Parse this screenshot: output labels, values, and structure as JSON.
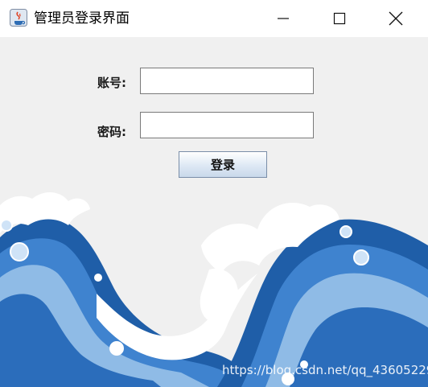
{
  "window": {
    "title": "管理员登录界面"
  },
  "form": {
    "account_label": "账号:",
    "account_value": "",
    "password_label": "密码:",
    "password_value": "",
    "login_label": "登录"
  },
  "watermark": "https://blog.csdn.net/qq_43605229",
  "colors": {
    "title_bg": "#ffffff",
    "window_bg": "#f0f0f0",
    "wave_dark": "#1f5ea8",
    "wave_mid": "#3f83cf",
    "wave_light": "#8fbbe6",
    "foam": "#ffffff"
  }
}
